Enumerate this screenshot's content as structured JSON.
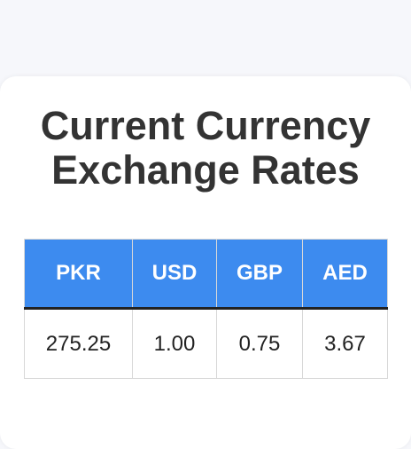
{
  "page": {
    "title_line1": "Current Currency",
    "title_line2": "Exchange Rates"
  },
  "table": {
    "headers": [
      "PKR",
      "USD",
      "GBP",
      "AED"
    ],
    "rows": [
      [
        "275.25",
        "1.00",
        "0.75",
        "3.67"
      ]
    ]
  },
  "colors": {
    "page_background": "#f6f7fb",
    "card_background": "#ffffff",
    "header_background": "#3d8bef",
    "header_text": "#ffffff",
    "title_text": "#333333",
    "cell_text": "#222222"
  }
}
